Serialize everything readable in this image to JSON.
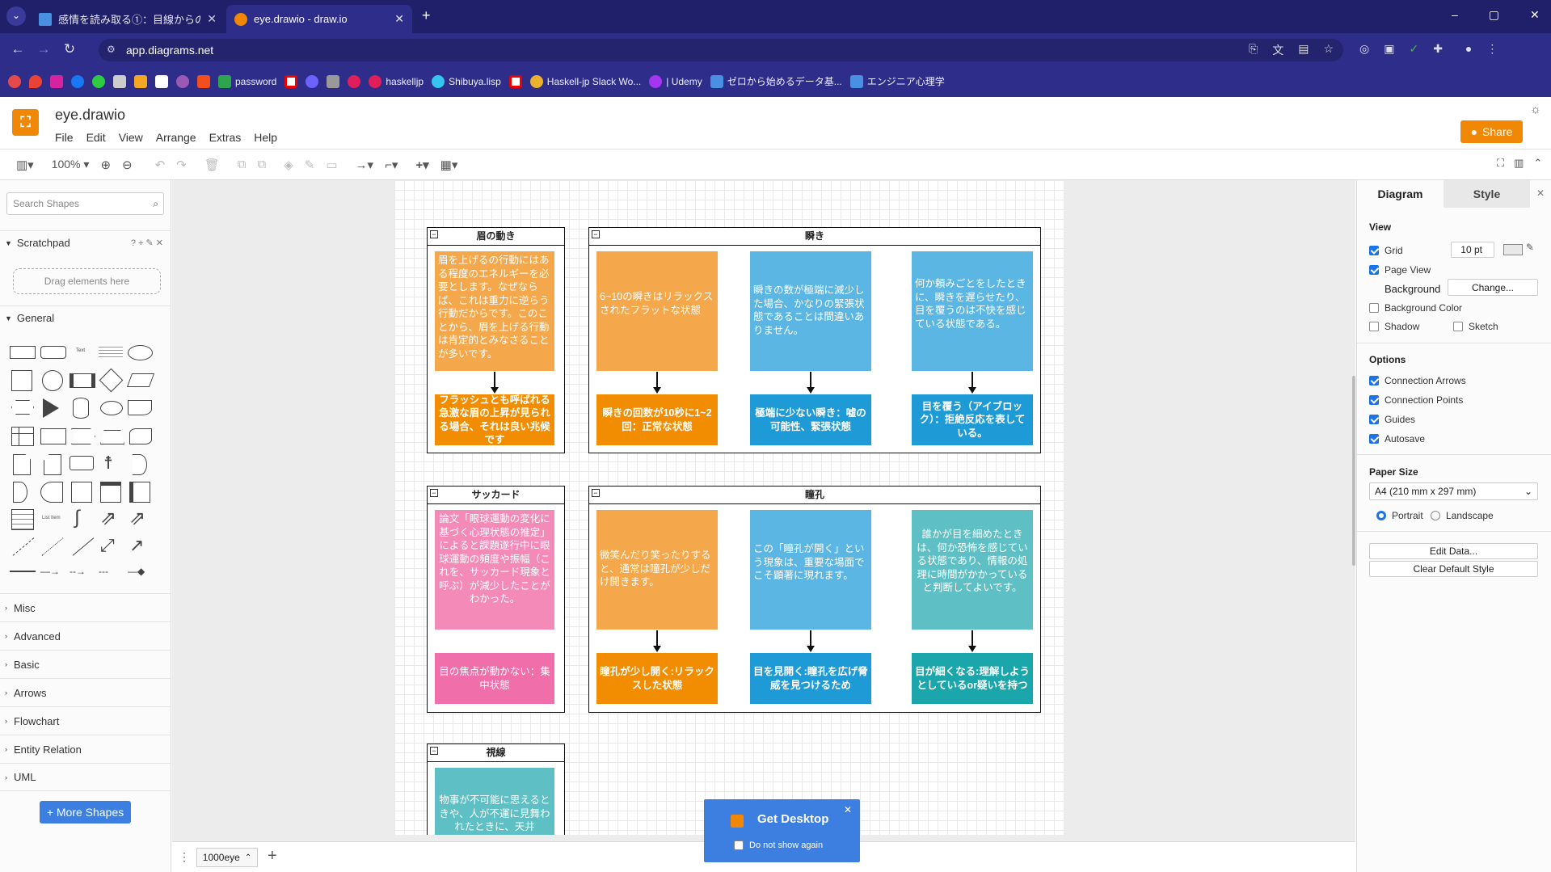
{
  "browser": {
    "tabs": [
      {
        "title": "感情を読み取る①：目線からの情",
        "active": false
      },
      {
        "title": "eye.drawio - draw.io",
        "active": true
      }
    ],
    "new_tab": "+",
    "url": "app.diagrams.net",
    "window_controls": [
      "–",
      "▢",
      "✕"
    ],
    "bookmarks": [
      {
        "label": "password",
        "icon_color": "#2ea44f"
      },
      {
        "label": "haskelljp",
        "icon_color": "#e01e5a"
      },
      {
        "label": "Shibuya.lisp",
        "icon_color": "#36c5f0"
      },
      {
        "label": "Haskell-jp Slack Wo...",
        "icon_color": "#ecb22e"
      },
      {
        "label": "| Udemy",
        "icon_color": "#a435f0"
      },
      {
        "label": "ゼロから始めるデータ基...",
        "icon_color": "#4a90e2"
      },
      {
        "label": "エンジニア心理学",
        "icon_color": "#4a90e2"
      }
    ]
  },
  "app": {
    "doc_title": "eye.drawio",
    "menu": [
      "File",
      "Edit",
      "View",
      "Arrange",
      "Extras",
      "Help"
    ],
    "share_label": "Share",
    "zoom": "100%"
  },
  "sidebar": {
    "search_placeholder": "Search Shapes",
    "scratchpad": "Scratchpad",
    "scratchpad_tools": "? + ✎ ✕",
    "drag_hint": "Drag elements here",
    "general": "General",
    "sections": [
      "Misc",
      "Advanced",
      "Basic",
      "Arrows",
      "Flowchart",
      "Entity Relation",
      "UML"
    ],
    "more_shapes": "+ More Shapes"
  },
  "diagram": {
    "groups": [
      {
        "title": "眉の動き",
        "cards": [
          {
            "text": "眉を上げるの行動にはある程度のエネルギーを必要とします。なぜならば、これは重力に逆らう行動だからです。このことから、眉を上げる行動は肯定的とみなさることが多いです。",
            "color": "#f5a84b"
          },
          {
            "text": "フラッシュとも呼ばれる急激な眉の上昇が見られる場合、それは良い兆候です",
            "color": "#f28c00"
          }
        ]
      },
      {
        "title": "瞬き",
        "cards": [
          {
            "text": "6~10の瞬きはリラックスされたフラットな状態",
            "color": "#f5a84b"
          },
          {
            "text": "瞬きの回数が10秒に1~2回：正常な状態",
            "color": "#f28c00"
          },
          {
            "text": "瞬きの数が極端に減少した場合、かなりの緊張状態であることは間違いありません。",
            "color": "#5bb6e3"
          },
          {
            "text": "極端に少ない瞬き：嘘の可能性、緊張状態",
            "color": "#1e9ad6"
          },
          {
            "text": "何か頼みごとをしたときに、瞬きを遅らせたり、目を覆うのは不快を感じている状態である。",
            "color": "#5bb6e3"
          },
          {
            "text": "目を覆う（アイブロック）：拒絶反応を表している。",
            "color": "#1e9ad6"
          }
        ]
      },
      {
        "title": "サッカード",
        "cards": [
          {
            "text": "論文「眼球運動の変化に基づく心理状態の推定」によると課題遂行中に眼球運動の頻度や振幅（これを、サッカード現象と呼ぶ）が減少したことがわかった。",
            "color": "#f48ab7"
          },
          {
            "text": "目の焦点が動かない：集中状態",
            "color": "#f06ea9"
          }
        ]
      },
      {
        "title": "瞳孔",
        "cards": [
          {
            "text": "微笑んだり笑ったりすると、通常は瞳孔が少しだけ開きます。",
            "color": "#f5a84b"
          },
          {
            "text": "瞳孔が少し開く:リラックスした状態",
            "color": "#f28c00"
          },
          {
            "text": "この「瞳孔が開く」という現象は、重要な場面でこそ顕著に現れます。",
            "color": "#5bb6e3"
          },
          {
            "text": "目を見開く:瞳孔を広げ脅威を見つけるため",
            "color": "#1e9ad6"
          },
          {
            "text": "誰かが目を細めたときは、何か恐怖を感じている状態であり、情報の処理に時間がかかっていると判断してよいです。",
            "color": "#5ec0c4"
          },
          {
            "text": "目が細くなる:理解しようとしているor疑いを持つ",
            "color": "#1aa6ab"
          }
        ]
      },
      {
        "title": "視線",
        "cards": [
          {
            "text": "物事が不可能に思えるときや、人が不運に見舞われたときに、天井",
            "color": "#5ec0c4"
          }
        ]
      }
    ]
  },
  "bottom": {
    "page_tab": "1000eye",
    "add": "+"
  },
  "format_panel": {
    "tabs": [
      "Diagram",
      "Style"
    ],
    "view_heading": "View",
    "grid_label": "Grid",
    "grid_size": "10 pt",
    "page_view": "Page View",
    "background": "Background",
    "change_btn": "Change...",
    "background_color": "Background Color",
    "shadow": "Shadow",
    "sketch": "Sketch",
    "options_heading": "Options",
    "options": [
      "Connection Arrows",
      "Connection Points",
      "Guides",
      "Autosave"
    ],
    "paper_size_heading": "Paper Size",
    "paper_size": "A4 (210 mm x 297 mm)",
    "portrait": "Portrait",
    "landscape": "Landscape",
    "edit_data": "Edit Data...",
    "clear_default_style": "Clear Default Style"
  },
  "popup": {
    "title": "Get Desktop",
    "checkbox": "Do not show again"
  },
  "colors": {
    "accent": "#f08705",
    "chrome": "#2e2e8a",
    "blue_button": "#3d7fe0"
  }
}
